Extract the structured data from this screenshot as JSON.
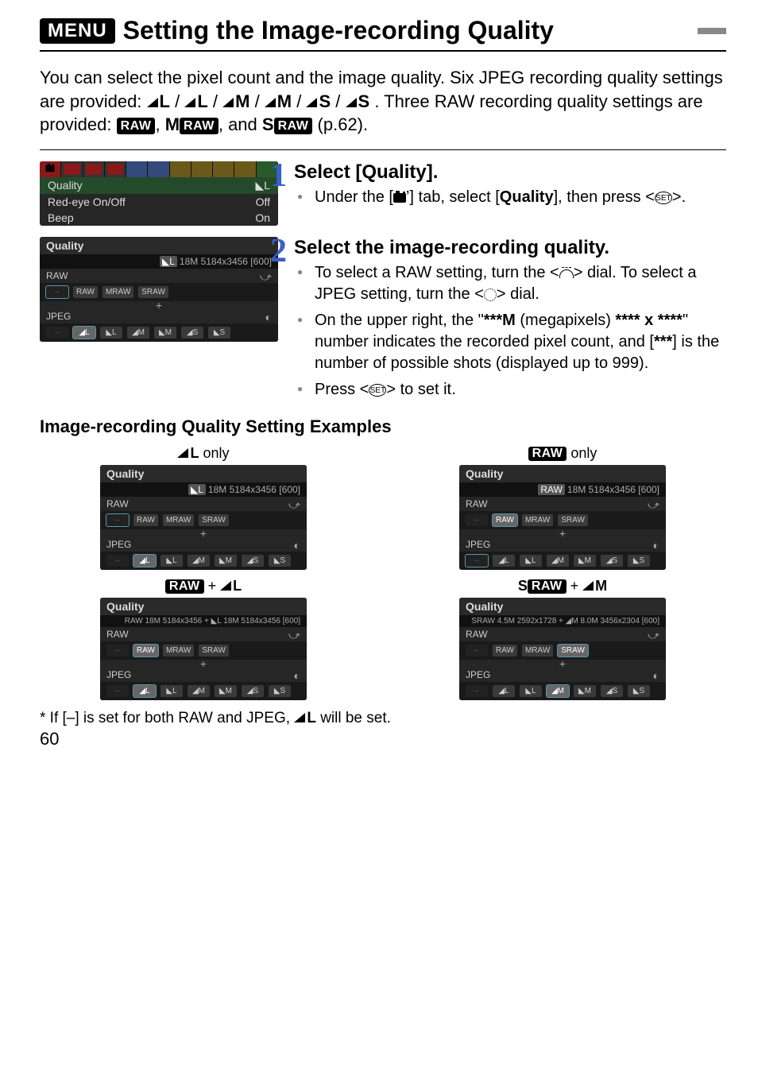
{
  "title": {
    "menu_badge": "MENU",
    "heading": "Setting the Image-recording Quality"
  },
  "intro": {
    "line1": "You can select the pixel count and the image quality. Six JPEG recording quality settings are provided: ",
    "three": ". Three RAW recording quality settings are provided: ",
    "ref": "(p.62)."
  },
  "q_icons": {
    "L": "L",
    "M": "M",
    "S": "S",
    "RAW": "RAW",
    "MRAW_pref": "M",
    "SRAW_pref": "S"
  },
  "cam_menu": {
    "quality_label": "Quality",
    "quality_value": "◣L",
    "redeye_label": "Red-eye On/Off",
    "redeye_value": "Off",
    "beep_label": "Beep",
    "beep_value": "On"
  },
  "cam_quality": {
    "hdr": "Quality",
    "info_icon": "◣L",
    "info": "18M 5184x3456 [600]",
    "raw_label": "RAW",
    "jpeg_label": "JPEG",
    "raw_opts": [
      "–",
      "RAW",
      "MRAW",
      "SRAW"
    ],
    "jpeg_opts": [
      "–",
      "◢L",
      "◣L",
      "◢M",
      "◣M",
      "◢S",
      "◣S"
    ]
  },
  "steps": {
    "s1": {
      "num": "1",
      "title": "Select [Quality].",
      "b1a": "Under the [",
      "b1b": "] tab, select [",
      "b1c": "Quality",
      "b1d": "], then press <",
      "b1e": ">."
    },
    "s2": {
      "num": "2",
      "title": "Select the image-recording quality.",
      "b1a": "To select a RAW setting, turn the <",
      "b1b": "> dial. To select a JPEG setting, turn the <",
      "b1c": "> dial.",
      "b2a": "On the upper right, the \"",
      "b2b": "***M",
      "b2c": " (megapixels) ",
      "b2d": "**** x ****",
      "b2e": "\" number indicates the recorded pixel count, and [",
      "b2f": "***",
      "b2g": "] is the number of possible shots (displayed up to 999).",
      "b3a": "Press <",
      "b3b": "> to set it."
    }
  },
  "exhead": "Image-recording Quality Setting Examples",
  "examples": {
    "e1": {
      "cap_suffix": " only",
      "info_pref": "◣L",
      "info": "18M 5184x3456 [600]"
    },
    "e2": {
      "cap_suffix": " only",
      "info_pref": "RAW",
      "info": "18M 5184x3456 [600]"
    },
    "e3": {
      "cap_mid": " + ",
      "info": "RAW 18M 5184x3456 + ◣L 18M 5184x3456 [600]"
    },
    "e4": {
      "cap_mid": " + ",
      "info": "SRAW 4.5M 2592x1728 + ◢M 8.0M 3456x2304 [600]"
    }
  },
  "footnote": {
    "a": "* If [–] is set for both RAW and JPEG, ",
    "b": " will be set."
  },
  "pagenum": "60",
  "chart_data": {
    "type": "table",
    "title": "Image-recording Quality setting examples",
    "rows": [
      {
        "example": "◣L only",
        "raw": "–",
        "jpeg": "◣L",
        "megapixels": "18M",
        "pixels": "5184x3456",
        "shots": 600
      },
      {
        "example": "RAW only",
        "raw": "RAW",
        "jpeg": "–",
        "megapixels": "18M",
        "pixels": "5184x3456",
        "shots": 600
      },
      {
        "example": "RAW + ◣L",
        "raw": "RAW",
        "jpeg": "◣L",
        "raw_mp": "18M",
        "raw_px": "5184x3456",
        "jpeg_mp": "18M",
        "jpeg_px": "5184x3456",
        "shots": 600
      },
      {
        "example": "S RAW + ◢M",
        "raw": "SRAW",
        "jpeg": "◢M",
        "raw_mp": "4.5M",
        "raw_px": "2592x1728",
        "jpeg_mp": "8.0M",
        "jpeg_px": "3456x2304",
        "shots": 600
      }
    ]
  }
}
